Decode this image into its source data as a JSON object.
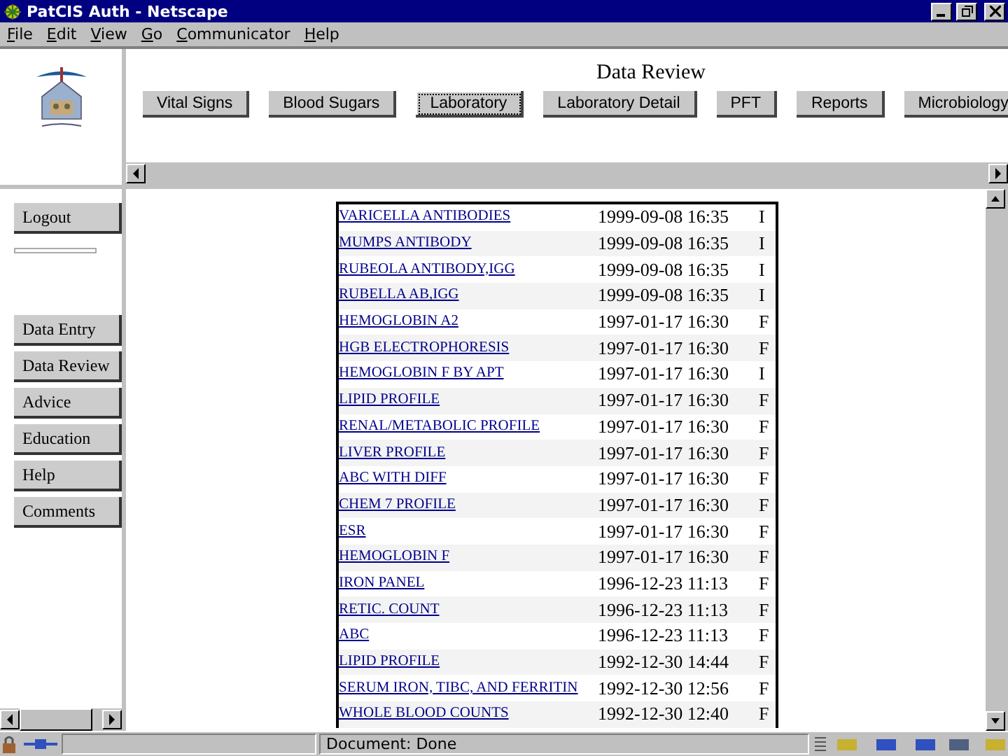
{
  "window": {
    "title": "PatCIS Auth - Netscape"
  },
  "menu": [
    "File",
    "Edit",
    "View",
    "Go",
    "Communicator",
    "Help"
  ],
  "header": {
    "title": "Data Review"
  },
  "tabs": [
    {
      "label": "Vital Signs",
      "selected": false
    },
    {
      "label": "Blood Sugars",
      "selected": false
    },
    {
      "label": "Laboratory",
      "selected": true
    },
    {
      "label": "Laboratory Detail",
      "selected": false
    },
    {
      "label": "PFT",
      "selected": false
    },
    {
      "label": "Reports",
      "selected": false
    },
    {
      "label": "Microbiology",
      "selected": false
    }
  ],
  "logout": "Logout",
  "nav": [
    "Data Entry",
    "Data Review",
    "Advice",
    "Education",
    "Help",
    "Comments"
  ],
  "table": {
    "rows": [
      {
        "test": "VARICELLA ANTIBODIES",
        "date": "1999-09-08 16:35",
        "column_3": "I"
      },
      {
        "test": "MUMPS ANTIBODY",
        "date": "1999-09-08 16:35",
        "column_3": "I"
      },
      {
        "test": "RUBEOLA ANTIBODY,IGG",
        "date": "1999-09-08 16:35",
        "column_3": "I"
      },
      {
        "test": "RUBELLA AB,IGG",
        "date": "1999-09-08 16:35",
        "column_3": "I"
      },
      {
        "test": "HEMOGLOBIN A2",
        "date": "1997-01-17 16:30",
        "column_3": "F"
      },
      {
        "test": "HGB ELECTROPHORESIS",
        "date": "1997-01-17 16:30",
        "column_3": "F"
      },
      {
        "test": "HEMOGLOBIN F BY APT",
        "date": "1997-01-17 16:30",
        "column_3": "I"
      },
      {
        "test": "LIPID PROFILE",
        "date": "1997-01-17 16:30",
        "column_3": "F"
      },
      {
        "test": "RENAL/METABOLIC PROFILE",
        "date": "1997-01-17 16:30",
        "column_3": "F"
      },
      {
        "test": "LIVER PROFILE",
        "date": "1997-01-17 16:30",
        "column_3": "F"
      },
      {
        "test": "ABC WITH DIFF",
        "date": "1997-01-17 16:30",
        "column_3": "F"
      },
      {
        "test": "CHEM 7 PROFILE",
        "date": "1997-01-17 16:30",
        "column_3": "F"
      },
      {
        "test": "ESR",
        "date": "1997-01-17 16:30",
        "column_3": "F"
      },
      {
        "test": "HEMOGLOBIN F",
        "date": "1997-01-17 16:30",
        "column_3": "F"
      },
      {
        "test": "IRON PANEL",
        "date": "1996-12-23 11:13",
        "column_3": "F"
      },
      {
        "test": "RETIC. COUNT",
        "date": "1996-12-23 11:13",
        "column_3": "F"
      },
      {
        "test": "ABC",
        "date": "1996-12-23 11:13",
        "column_3": "F"
      },
      {
        "test": "LIPID PROFILE",
        "date": "1992-12-30 14:44",
        "column_3": "F"
      },
      {
        "test": "SERUM IRON, TIBC, AND FERRITIN",
        "date": "1992-12-30 12:56",
        "column_3": "F"
      },
      {
        "test": "WHOLE BLOOD COUNTS",
        "date": "1992-12-30 12:40",
        "column_3": "F"
      }
    ]
  },
  "status_bar": {
    "text": "Document: Done"
  }
}
